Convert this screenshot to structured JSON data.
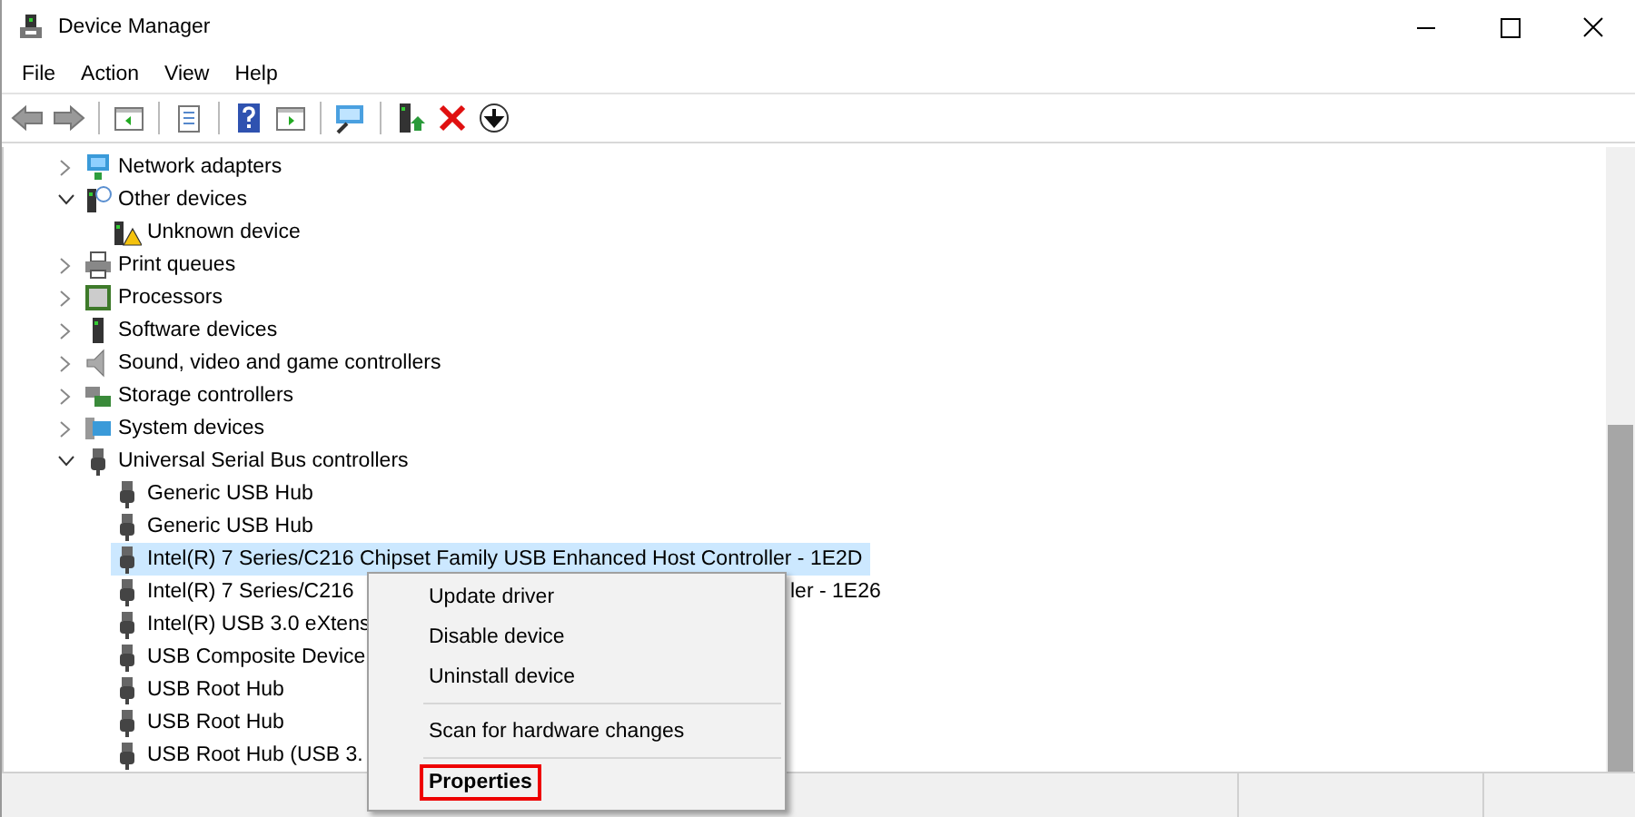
{
  "window": {
    "title": "Device Manager"
  },
  "menu_bar": [
    {
      "label": "File"
    },
    {
      "label": "Action"
    },
    {
      "label": "View"
    },
    {
      "label": "Help"
    }
  ],
  "tree": [
    {
      "label": "Network adapters",
      "kind": "network",
      "expanded": false
    },
    {
      "label": "Other devices",
      "kind": "unknown",
      "expanded": true,
      "children": [
        {
          "label": "Unknown device",
          "kind": "warning",
          "selected": false
        }
      ]
    },
    {
      "label": "Print queues",
      "kind": "printer",
      "expanded": false
    },
    {
      "label": "Processors",
      "kind": "cpu",
      "expanded": false
    },
    {
      "label": "Software devices",
      "kind": "software",
      "expanded": false
    },
    {
      "label": "Sound, video and game controllers",
      "kind": "sound",
      "expanded": false
    },
    {
      "label": "Storage controllers",
      "kind": "storage",
      "expanded": false
    },
    {
      "label": "System devices",
      "kind": "system",
      "expanded": false
    },
    {
      "label": "Universal Serial Bus controllers",
      "kind": "usb",
      "expanded": true,
      "children": [
        {
          "label": "Generic USB Hub",
          "kind": "usb",
          "selected": false
        },
        {
          "label": "Generic USB Hub",
          "kind": "usb",
          "selected": false
        },
        {
          "label": "Intel(R) 7 Series/C216 Chipset Family USB Enhanced Host Controller - 1E2D",
          "kind": "usb",
          "selected": true
        },
        {
          "label": "Intel(R) 7 Series/C216",
          "label_right": "ler - 1E26",
          "kind": "usb",
          "selected": false
        },
        {
          "label": "Intel(R) USB 3.0 eXtens",
          "kind": "usb",
          "selected": false
        },
        {
          "label": "USB Composite Device",
          "kind": "usb",
          "selected": false
        },
        {
          "label": "USB Root Hub",
          "kind": "usb",
          "selected": false
        },
        {
          "label": "USB Root Hub",
          "kind": "usb",
          "selected": false
        },
        {
          "label": "USB Root Hub (USB 3.",
          "kind": "usb",
          "selected": false
        }
      ]
    }
  ],
  "context_menu": [
    {
      "kind": "item",
      "label": "Update driver",
      "default": false,
      "outlined": false
    },
    {
      "kind": "item",
      "label": "Disable device",
      "default": false,
      "outlined": false
    },
    {
      "kind": "item",
      "label": "Uninstall device",
      "default": false,
      "outlined": false
    },
    {
      "kind": "separator"
    },
    {
      "kind": "item",
      "label": "Scan for hardware changes",
      "default": false,
      "outlined": false
    },
    {
      "kind": "separator"
    },
    {
      "kind": "item",
      "label": "Properties",
      "default": true,
      "outlined": true
    }
  ]
}
